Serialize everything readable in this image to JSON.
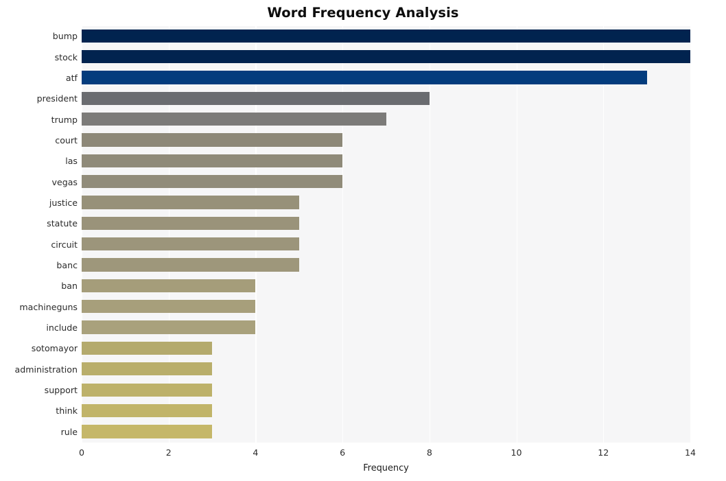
{
  "chart_data": {
    "type": "bar",
    "orientation": "horizontal",
    "title": "Word Frequency Analysis",
    "xlabel": "Frequency",
    "ylabel": "",
    "categories": [
      "bump",
      "stock",
      "atf",
      "president",
      "trump",
      "court",
      "las",
      "vegas",
      "justice",
      "statute",
      "circuit",
      "banc",
      "ban",
      "machineguns",
      "include",
      "sotomayor",
      "administration",
      "support",
      "think",
      "rule"
    ],
    "values": [
      14,
      14,
      13,
      8,
      7,
      6,
      6,
      6,
      5,
      5,
      5,
      5,
      4,
      4,
      4,
      3,
      3,
      3,
      3,
      3
    ],
    "bar_colors": [
      "#01234f",
      "#01234f",
      "#033c7d",
      "#6a6c70",
      "#7c7b79",
      "#8d8878",
      "#8f8a79",
      "#918c7a",
      "#979179",
      "#9a937a",
      "#9c957b",
      "#9e977b",
      "#a59d7a",
      "#a79f7b",
      "#a9a17c",
      "#b4aa6d",
      "#b9ae6b",
      "#bdb16a",
      "#c1b469",
      "#c5b769"
    ],
    "xlim": [
      0,
      14
    ],
    "ylim_count": 20,
    "xticks": [
      0,
      2,
      4,
      6,
      8,
      10,
      12,
      14
    ],
    "xtick_labels": [
      "0",
      "2",
      "4",
      "6",
      "8",
      "10",
      "12",
      "14"
    ],
    "grid": true,
    "grid_axis": "x",
    "grid_color": "#ffffff",
    "plot_background": "#f6f6f7",
    "figure_background": "#ffffff",
    "legend": null,
    "annotations": []
  }
}
